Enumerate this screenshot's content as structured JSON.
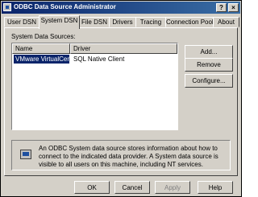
{
  "window": {
    "title": "ODBC Data Source Administrator",
    "help_glyph": "?",
    "close_glyph": "×"
  },
  "tabs": [
    {
      "label": "User DSN"
    },
    {
      "label": "System DSN"
    },
    {
      "label": "File DSN"
    },
    {
      "label": "Drivers"
    },
    {
      "label": "Tracing"
    },
    {
      "label": "Connection Pooling"
    },
    {
      "label": "About"
    }
  ],
  "system_dsn": {
    "list_label": "System Data Sources:",
    "columns": [
      "Name",
      "Driver"
    ],
    "rows": [
      {
        "name": "VMware VirtualCenter",
        "driver": "SQL Native Client"
      }
    ],
    "buttons": {
      "add": "Add...",
      "remove": "Remove",
      "configure": "Configure..."
    },
    "info_text": "An ODBC System data source stores information about how to connect to the indicated data provider.  A System data source is visible to all users on this machine, including NT services."
  },
  "footer": {
    "ok": "OK",
    "cancel": "Cancel",
    "apply": "Apply",
    "help": "Help"
  }
}
